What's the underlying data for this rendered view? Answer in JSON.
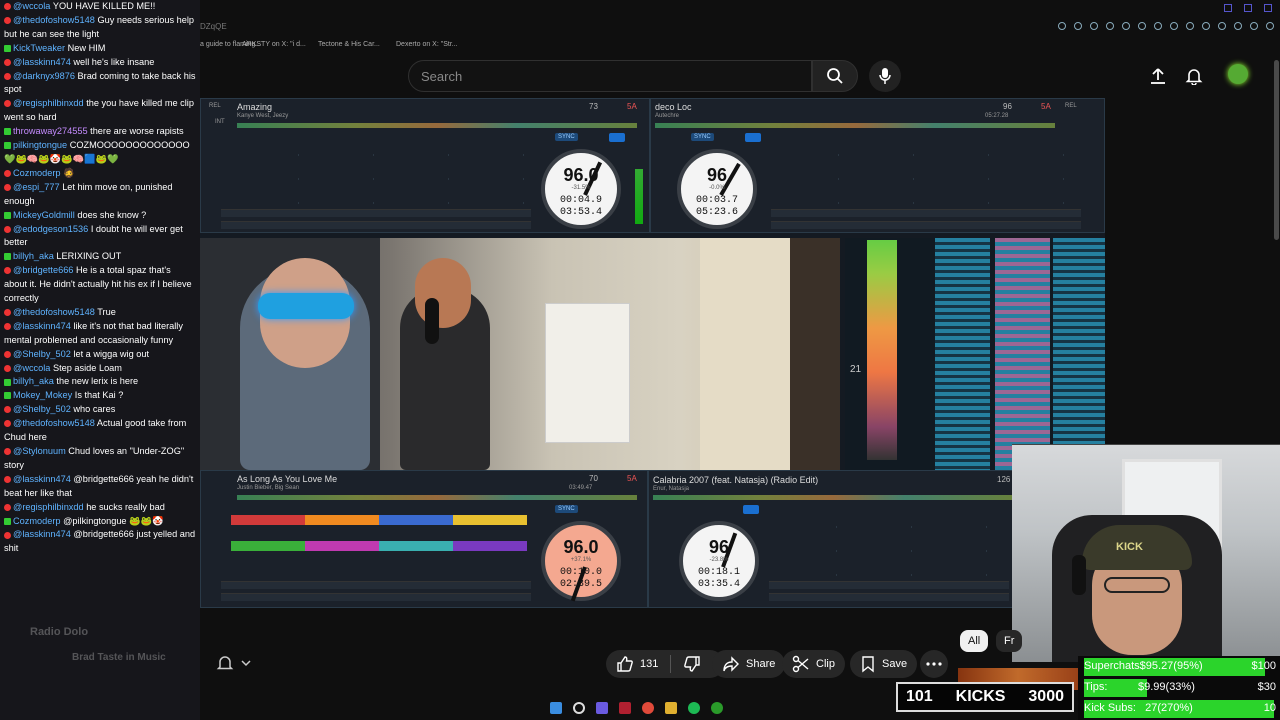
{
  "browser": {
    "url_fragment": "DZqQE",
    "bookmarks": [
      "a guide to flaming...",
      "ARKSTY on X: \"i d...",
      "Tectone & His Car...",
      "Dexerto on X: \"Str..."
    ]
  },
  "header": {
    "search_placeholder": "Search"
  },
  "dj": {
    "deck_a": {
      "title": "Amazing",
      "artist": "Kanye West, Jeezy",
      "bpm_small": "73",
      "key": "5A",
      "jog_bpm": "96.0",
      "pitch": "-31.5%",
      "elapsed": "00:04.9",
      "remain": "03:53.4"
    },
    "deck_b": {
      "title": "deco Loc",
      "artist": "Autechre",
      "bpm_small": "96",
      "key": "5A",
      "jog_bpm": "96",
      "pitch": "-0.0%",
      "elapsed": "00:03.7",
      "remain": "05:23.6",
      "duration": "05:27.28"
    },
    "deck_c": {
      "title": "As Long As You Love Me",
      "artist": "Justin Bieber, Big Sean",
      "bpm_small": "70",
      "key": "5A",
      "jog_bpm": "96.0",
      "pitch": "+37.1%",
      "elapsed": "00:10.0",
      "remain": "02:39.5",
      "duration": "03:49.47"
    },
    "deck_d": {
      "title": "Calabria 2007 (feat. Natasja) (Radio Edit)",
      "artist": "Enur, Natasja",
      "bpm_small": "126",
      "jog_bpm": "96",
      "pitch": "-23.8%",
      "elapsed": "00:18.1",
      "remain": "03:35.4"
    },
    "waveform_num": "21",
    "sync": "SYNC",
    "rel": "REL",
    "int": "INT"
  },
  "chat": [
    {
      "user": "@wccola",
      "badge": "red",
      "color": "#5fb3ff",
      "text": "YOU HAVE KILLED ME!!"
    },
    {
      "user": "@thedofoshow5148",
      "badge": "red",
      "color": "#5fb3ff",
      "text": "Guy needs serious help but he can see the light"
    },
    {
      "user": "KickTweaker",
      "badge": "green",
      "color": "#5fb3ff",
      "text": "New HIM"
    },
    {
      "user": "@lasskinn474",
      "badge": "red",
      "color": "#5fb3ff",
      "text": "well he's like insane"
    },
    {
      "user": "@darknyx9876",
      "badge": "red",
      "color": "#5fb3ff",
      "text": "Brad coming to take back his spot"
    },
    {
      "user": "@regisphilbinxdd",
      "badge": "red",
      "color": "#5fb3ff",
      "text": "the you have killed me clip went so hard"
    },
    {
      "user": "throwaway274555",
      "badge": "green",
      "color": "#c58cff",
      "text": "there are worse rapists"
    },
    {
      "user": "pilkingtongue",
      "badge": "green",
      "color": "#5fb3ff",
      "text": "COZMOOOOOOOOOOOOO"
    },
    {
      "user": "",
      "badge": "",
      "color": "#fff",
      "text": "💚🐸🧠🐸🤡🐸🧠🟦🐸💚"
    },
    {
      "user": "Cozmoderp",
      "badge": "red",
      "color": "#5fb3ff",
      "text": "🧔"
    },
    {
      "user": "@espi_777",
      "badge": "red",
      "color": "#5fb3ff",
      "text": "Let him move on, punished enough"
    },
    {
      "user": "MickeyGoldmill",
      "badge": "green",
      "color": "#5fb3ff",
      "text": "does she know ?"
    },
    {
      "user": "@edodgeson1536",
      "badge": "red",
      "color": "#5fb3ff",
      "text": "I doubt he will ever get better"
    },
    {
      "user": "billyh_aka",
      "badge": "green",
      "color": "#5fb3ff",
      "text": "LERIXING OUT"
    },
    {
      "user": "@bridgette666",
      "badge": "red",
      "color": "#5fb3ff",
      "text": "He is a total spaz that's about it. He didn't actually hit his ex if I believe correctly"
    },
    {
      "user": "@thedofoshow5148",
      "badge": "red",
      "color": "#5fb3ff",
      "text": "True"
    },
    {
      "user": "@lasskinn474",
      "badge": "red",
      "color": "#5fb3ff",
      "text": "like it's not that bad literally mental problemed and occasionally funny"
    },
    {
      "user": "@Shelby_502",
      "badge": "red",
      "color": "#5fb3ff",
      "text": "let a wigga wig out"
    },
    {
      "user": "@wccola",
      "badge": "red",
      "color": "#5fb3ff",
      "text": "Step aside Loam"
    },
    {
      "user": "billyh_aka",
      "badge": "green",
      "color": "#5fb3ff",
      "text": "the new lerix is here"
    },
    {
      "user": "Mokey_Mokey",
      "badge": "green",
      "color": "#5fb3ff",
      "text": "Is that Kai ?"
    },
    {
      "user": "@Shelby_502",
      "badge": "red",
      "color": "#5fb3ff",
      "text": "who cares"
    },
    {
      "user": "@thedofoshow5148",
      "badge": "red",
      "color": "#5fb3ff",
      "text": "Actual good take from Chud here"
    },
    {
      "user": "@Stylonuum",
      "badge": "red",
      "color": "#5fb3ff",
      "text": "Chud loves an \"Under-ZOG\" story"
    },
    {
      "user": "@lasskinn474",
      "badge": "red",
      "color": "#5fb3ff",
      "text": "@bridgette666 yeah he didn't beat her like that"
    },
    {
      "user": "@regisphilbinxdd",
      "badge": "red",
      "color": "#5fb3ff",
      "text": "he sucks really bad"
    },
    {
      "user": "Cozmoderp",
      "badge": "green",
      "color": "#5fb3ff",
      "text": "@pilkingtongue 🐸🐸🤡"
    },
    {
      "user": "@lasskinn474",
      "badge": "red",
      "color": "#5fb3ff",
      "text": "@bridgette666 just yelled and shit"
    }
  ],
  "chat_ghost": {
    "line1": "Radio Dolo",
    "line2": "Brad Taste in Music"
  },
  "actions": {
    "like_count": "131",
    "share": "Share",
    "clip": "Clip",
    "save": "Save"
  },
  "chips": {
    "all": "All",
    "fr": "Fr"
  },
  "overlay": {
    "kicks_count": "101",
    "kicks_label": "KICKS",
    "kicks_goal": "3000",
    "goals": [
      {
        "label": "Superchats",
        "value": "$95.27(95%)",
        "target": "$100",
        "fill_color": "#2bd42b",
        "fill": 0.95
      },
      {
        "label": "Tips:",
        "value": "$9.99(33%)",
        "target": "$30",
        "fill_color": "#2bd42b",
        "fill": 0.33
      },
      {
        "label": "Kick Subs:",
        "value": "27(270%)",
        "target": "10",
        "fill_color": "#2bd42b",
        "fill": 1.0
      }
    ]
  },
  "facecam": {
    "cap_text": "KICK"
  }
}
